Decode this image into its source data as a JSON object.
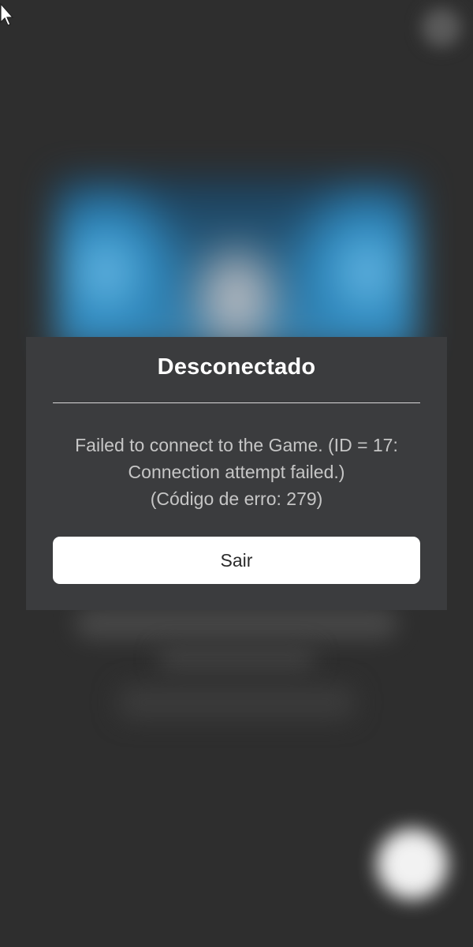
{
  "dialog": {
    "title": "Desconectado",
    "message_line1": "Failed to connect to the Game. (ID = 17:",
    "message_line2": "Connection attempt failed.)",
    "error_code_line": "(Código de erro: 279)",
    "exit_button_label": "Sair"
  },
  "icons": {
    "cursor": "cursor-icon"
  },
  "colors": {
    "background": "#2e2e2e",
    "dialog_background": "#3b3c3e",
    "title_text": "#ffffff",
    "message_text": "#c6c6c6",
    "button_background": "#ffffff",
    "button_text": "#2b2b2b"
  }
}
